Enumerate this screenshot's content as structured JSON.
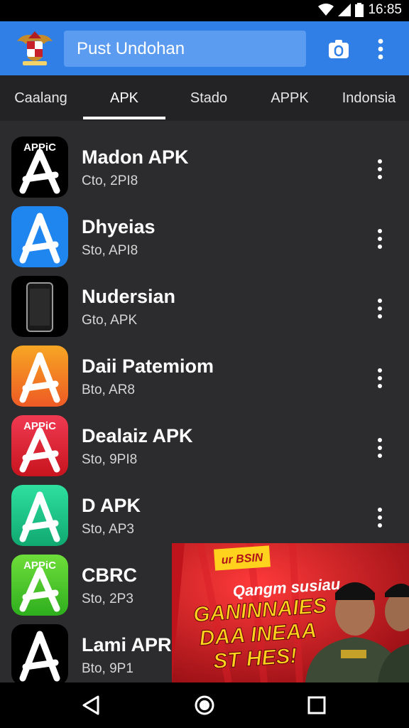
{
  "status_bar": {
    "time": "16:85"
  },
  "app_bar": {
    "search_text": "Pust Undohan",
    "camera_icon": "camera-icon",
    "overflow_icon": "more-vert-icon"
  },
  "tabs": [
    {
      "label": "Caalang"
    },
    {
      "label": "APK",
      "selected": true
    },
    {
      "label": "Stado"
    },
    {
      "label": "APPK"
    },
    {
      "label": "Indonsia"
    }
  ],
  "apps": [
    {
      "title": "Madon APK",
      "subtitle": "Cto, 2PI8",
      "icon_color": "#000000",
      "icon_badge": "APPiC",
      "icon": "app-store-icon"
    },
    {
      "title": "Dhyeias",
      "subtitle": "Sto, API8",
      "icon_color": "#1f86f0",
      "icon_badge": "",
      "icon": "app-store-icon"
    },
    {
      "title": "Nudersian",
      "subtitle": "Gto, APK",
      "icon_color": "#000000",
      "icon_badge": "",
      "icon": "phone-icon"
    },
    {
      "title": "Daii Patemiom",
      "subtitle": "Bto, AR8",
      "icon_color": "#f58a1f",
      "icon_badge": "",
      "icon": "app-store-icon"
    },
    {
      "title": "Dealaiz APK",
      "subtitle": "Sto, 9PI8",
      "icon_color": "#e8283c",
      "icon_badge": "APPiC",
      "icon": "app-store-icon"
    },
    {
      "title": "D APK",
      "subtitle": "Sto, AP3",
      "icon_color": "#1ec48a",
      "icon_badge": "",
      "icon": "app-store-icon"
    },
    {
      "title": "CBRC",
      "subtitle": "Sto, 2P3",
      "icon_color": "#4ccc2c",
      "icon_badge": "APPiC",
      "icon": "app-store-icon"
    },
    {
      "title": "Lami APR",
      "subtitle": "Bto, 9P1",
      "icon_color": "#000000",
      "icon_badge": "",
      "icon": "app-store-icon"
    }
  ],
  "ad": {
    "tag": "ur BSIN",
    "line1": "Qangm susiau",
    "line2": "GANINNAIES",
    "line3": "DAA INEAA",
    "line4": "ST HES!"
  },
  "nav_bar": {
    "back_icon": "back-icon",
    "home_icon": "home-icon",
    "recents_icon": "recents-icon"
  },
  "colors": {
    "app_bar": "#2f7fe6",
    "background": "#2c2c2e",
    "ad_red": "#c0141c",
    "ad_yellow": "#ffd21e"
  }
}
